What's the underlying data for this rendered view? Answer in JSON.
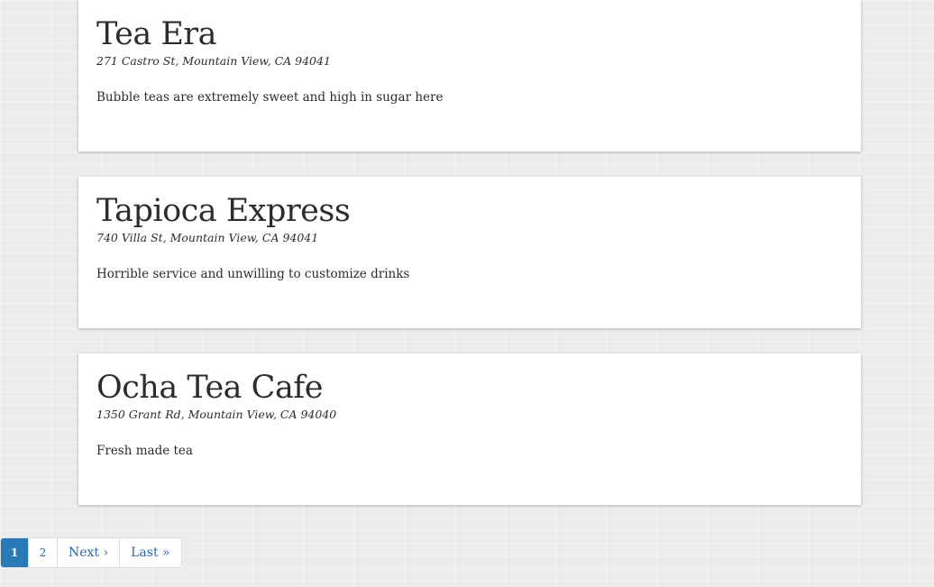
{
  "listings": [
    {
      "name": "Tea Era",
      "address": "271 Castro St, Mountain View, CA 94041",
      "review": "Bubble teas are extremely sweet and high in sugar here"
    },
    {
      "name": "Tapioca Express",
      "address": "740 Villa St, Mountain View, CA 94041",
      "review": "Horrible service and unwilling to customize drinks"
    },
    {
      "name": "Ocha Tea Cafe",
      "address": "1350 Grant Rd, Mountain View, CA 94040",
      "review": "Fresh made tea"
    }
  ],
  "pagination": {
    "current": "1",
    "page_2": "2",
    "next": "Next ›",
    "last": "Last »"
  },
  "colors": {
    "link": "#2a6aa8",
    "active_page_bg": "#2a7ab8",
    "card_bg": "#ffffff",
    "page_bg": "#ececec"
  }
}
